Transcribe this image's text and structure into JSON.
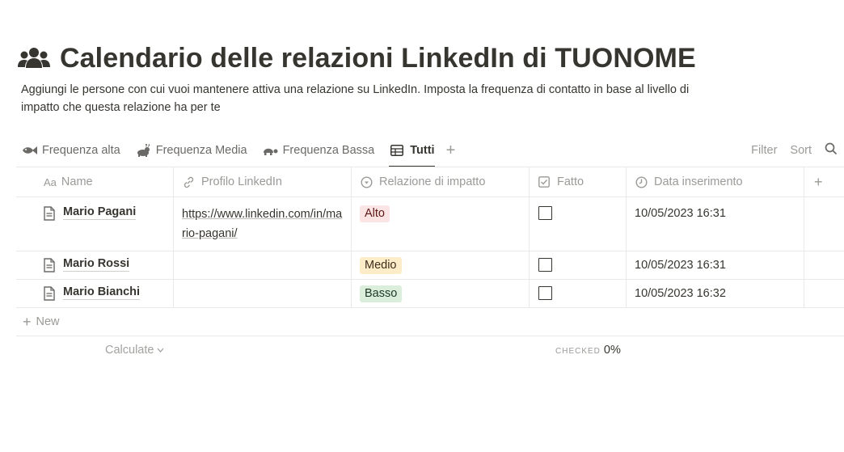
{
  "page": {
    "title": "Calendario delle relazioni LinkedIn di TUONOME",
    "title_icon": "people-icon",
    "description": "Aggiungi le persone con cui vuoi mantenere attiva una relazione su LinkedIn. Imposta la frequenza di contatto in base al livello di impatto che questa relazione ha per te"
  },
  "views": {
    "tabs": [
      {
        "label": "Frequenza alta",
        "icon": "fish-icon"
      },
      {
        "label": "Frequenza Media",
        "icon": "rabbit-icon"
      },
      {
        "label": "Frequenza Bassa",
        "icon": "turtle-icon"
      },
      {
        "label": "Tutti",
        "icon": "table-icon",
        "active": true
      }
    ],
    "add_icon": "plus-icon",
    "filter_label": "Filter",
    "sort_label": "Sort",
    "search_icon": "search-icon"
  },
  "table": {
    "columns": [
      {
        "label": "Name",
        "icon": "text-icon",
        "prefix": "Aa"
      },
      {
        "label": "Profilo LinkedIn",
        "icon": "link-icon"
      },
      {
        "label": "Relazione di impatto",
        "icon": "select-icon"
      },
      {
        "label": "Fatto",
        "icon": "checkbox-icon"
      },
      {
        "label": "Data inserimento",
        "icon": "clock-icon"
      }
    ],
    "rows": [
      {
        "name": "Mario Pagani",
        "linkedin": "https://www.linkedin.com/in/mario-pagani/",
        "impact": "Alto",
        "done": false,
        "date": "10/05/2023 16:31"
      },
      {
        "name": "Mario Rossi",
        "linkedin": "",
        "impact": "Medio",
        "done": false,
        "date": "10/05/2023 16:31"
      },
      {
        "name": "Mario Bianchi",
        "linkedin": "",
        "impact": "Basso",
        "done": false,
        "date": "10/05/2023 16:32"
      }
    ],
    "new_label": "New",
    "calculate_label": "Calculate",
    "checked_label": "CHECKED",
    "checked_value": "0%"
  },
  "colors": {
    "tag_alto": "#fbe4e4",
    "tag_medio": "#fdecc8",
    "tag_basso": "#dbeddb",
    "text": "#37352f",
    "muted": "#9b9a97"
  }
}
